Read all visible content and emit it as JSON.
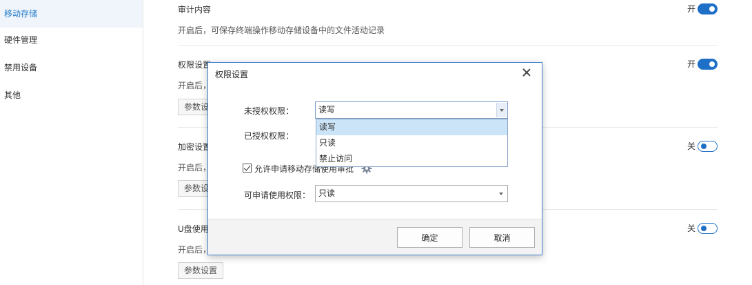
{
  "sidebar": {
    "items": [
      {
        "label": "移动存储",
        "active": true
      },
      {
        "label": "硬件管理",
        "active": false
      },
      {
        "label": "禁用设备",
        "active": false
      },
      {
        "label": "其他",
        "active": false
      }
    ]
  },
  "sections": {
    "audit": {
      "title": "审计内容",
      "desc": "开启后，可保存终端操作移动存储设备中的文件活动记录",
      "toggle_label": "开",
      "toggle_on": true
    },
    "permission": {
      "title": "权限设置",
      "desc": "开启后，",
      "button": "参数设置",
      "toggle_label": "开",
      "toggle_on": true
    },
    "encrypt": {
      "title": "加密设置",
      "desc": "开启后，",
      "button": "参数设置",
      "toggle_label": "关",
      "toggle_on": false
    },
    "usb": {
      "title": "U盘使用",
      "desc": "开启后，",
      "button": "参数设置",
      "toggle_label": "关",
      "toggle_on": false
    }
  },
  "dialog": {
    "title": "权限设置",
    "unauthorized_label": "未授权权限：",
    "unauthorized_value": "读写",
    "authorized_label": "已授权权限：",
    "dropdown_options": [
      "读写",
      "只读",
      "禁止访问"
    ],
    "dropdown_selected_index": 0,
    "allow_request_label": "允许申请移动存储使用审批",
    "allow_request_checked": true,
    "requestable_label": "可申请使用权限：",
    "requestable_value": "只读",
    "confirm_label": "确定",
    "cancel_label": "取消"
  },
  "colors": {
    "accent": "#1e6fc6",
    "active_text": "#1e78c8",
    "dialog_border": "#3e7fce",
    "option_highlight": "#cce4f7"
  }
}
